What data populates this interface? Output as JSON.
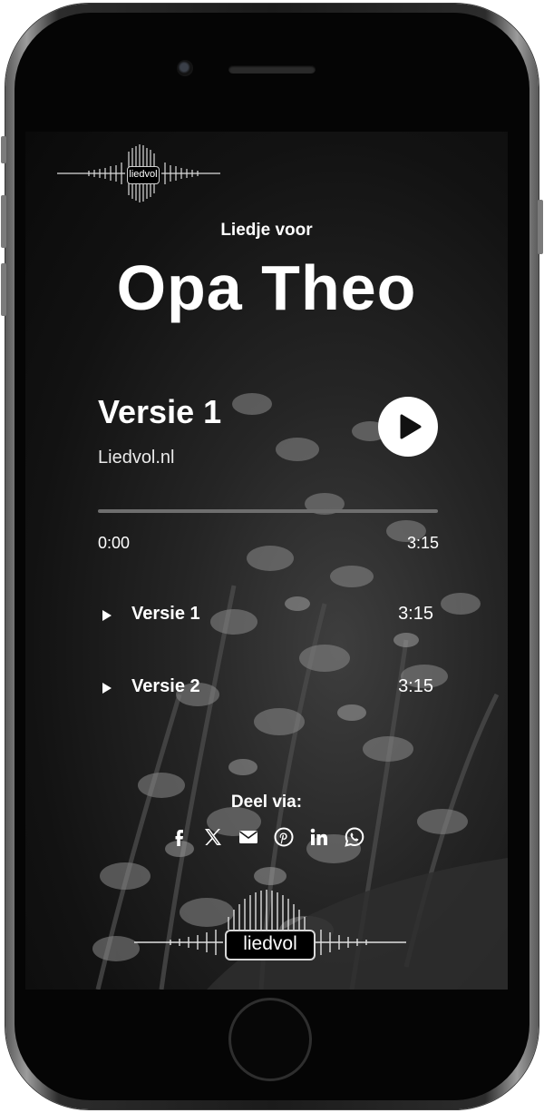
{
  "brand": {
    "logo_text": "liedvol"
  },
  "header": {
    "kicker": "Liedje voor",
    "title": "Opa Theo"
  },
  "player": {
    "current_title": "Versie 1",
    "artist": "Liedvol.nl",
    "play_icon": "play-icon",
    "progress": 0,
    "time_current": "0:00",
    "time_total": "3:15"
  },
  "tracks": [
    {
      "name": "Versie 1",
      "duration": "3:15"
    },
    {
      "name": "Versie 2",
      "duration": "3:15"
    }
  ],
  "share": {
    "label": "Deel via:",
    "icons": [
      "facebook-icon",
      "x-icon",
      "email-icon",
      "pinterest-icon",
      "linkedin-icon",
      "whatsapp-icon"
    ]
  },
  "colors": {
    "text": "#ffffff",
    "track": "#6e6e6e",
    "background": "#1a1a1a"
  }
}
